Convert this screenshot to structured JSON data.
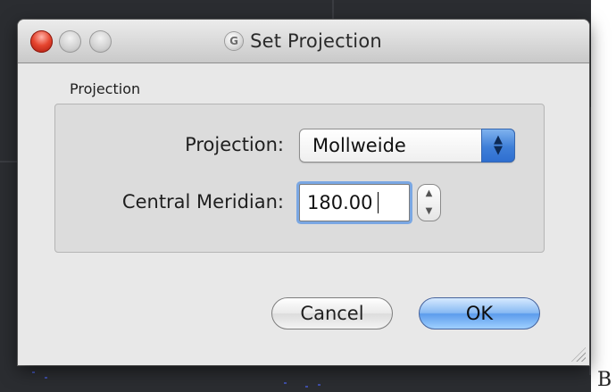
{
  "window": {
    "title": "Set Projection",
    "app_icon_glyph": "G",
    "app_icon": "app-g-icon"
  },
  "group": {
    "label": "Projection"
  },
  "fields": {
    "projection_label": "Projection:",
    "projection_value": "Mollweide",
    "central_meridian_label": "Central Meridian:",
    "central_meridian_value": "180.00"
  },
  "buttons": {
    "cancel": "Cancel",
    "ok": "OK"
  },
  "stray_text": "B",
  "colors": {
    "default_button": "#5c9cec",
    "focus_ring": "#7aa7e3",
    "close_button": "#e5452f"
  }
}
